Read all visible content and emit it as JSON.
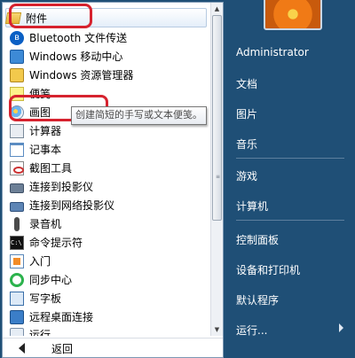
{
  "programs": [
    {
      "label": "附件",
      "icon": "folder-open-icon"
    },
    {
      "label": "Bluetooth 文件传送",
      "icon": "bluetooth-icon"
    },
    {
      "label": "Windows 移动中心",
      "icon": "mobility-center-icon"
    },
    {
      "label": "Windows 资源管理器",
      "icon": "explorer-icon"
    },
    {
      "label": "便笺",
      "icon": "sticky-notes-icon"
    },
    {
      "label": "画图",
      "icon": "paint-icon"
    },
    {
      "label": "计算器",
      "icon": "calculator-icon"
    },
    {
      "label": "记事本",
      "icon": "notepad-icon"
    },
    {
      "label": "截图工具",
      "icon": "snipping-tool-icon"
    },
    {
      "label": "连接到投影仪",
      "icon": "projector-icon"
    },
    {
      "label": "连接到网络投影仪",
      "icon": "network-projector-icon"
    },
    {
      "label": "录音机",
      "icon": "microphone-icon"
    },
    {
      "label": "命令提示符",
      "icon": "command-prompt-icon"
    },
    {
      "label": "入门",
      "icon": "getting-started-icon"
    },
    {
      "label": "同步中心",
      "icon": "sync-center-icon"
    },
    {
      "label": "写字板",
      "icon": "wordpad-icon"
    },
    {
      "label": "远程桌面连接",
      "icon": "remote-desktop-icon"
    },
    {
      "label": "运行",
      "icon": "run-icon"
    }
  ],
  "tooltip": "创建简短的手写或文本便笺。",
  "back_label": "返回",
  "right_menu": {
    "user": "Administrator",
    "items": [
      "文档",
      "图片",
      "音乐",
      "游戏",
      "计算机",
      "控制面板",
      "设备和打印机",
      "默认程序",
      "运行..."
    ]
  },
  "colors": {
    "background": "#1f4f76",
    "annotation": "#d6222e",
    "pane": "#ffffff"
  }
}
